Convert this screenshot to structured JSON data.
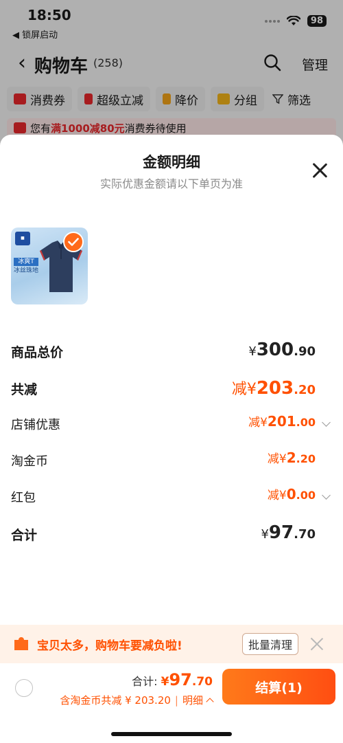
{
  "status_bar": {
    "time": "18:50",
    "back_label": "◀ 锁屏启动",
    "battery": "98"
  },
  "cart_header": {
    "back": "‹",
    "title": "购物车",
    "count": "(258)",
    "manage": "管理"
  },
  "filters": [
    {
      "label": "消费券",
      "color": "#e8272b"
    },
    {
      "label": "超级立减",
      "color": "#e8272b"
    },
    {
      "label": "降价",
      "color": "#f2a21a"
    },
    {
      "label": "分组",
      "color": "#f2b31a"
    },
    {
      "label": "筛选",
      "color": "#333333"
    }
  ],
  "coupon_banner": {
    "prefix": "您有",
    "highlight": "满1000减80元",
    "suffix": "消费券待使用"
  },
  "sheet": {
    "title": "金额明细",
    "subtitle": "实际优惠金额请以下单页为准",
    "product_thumb": {
      "tag_line1": "冰爽T",
      "tag_line2": "冰丝珠地"
    },
    "rows": [
      {
        "label": "商品总价",
        "prefix": "¥",
        "int": "300",
        "dec": ".90"
      },
      {
        "label": "共减",
        "prefix": "减¥",
        "int": "203",
        "dec": ".20"
      },
      {
        "label": "店铺优惠",
        "prefix": "减¥",
        "int": "201",
        "dec": ".00"
      },
      {
        "label": "淘金币",
        "prefix": "减¥",
        "int": "2",
        "dec": ".20"
      },
      {
        "label": "红包",
        "prefix": "减¥",
        "int": "0",
        "dec": ".00"
      },
      {
        "label": "合计",
        "prefix": "¥",
        "int": "97",
        "dec": ".70"
      }
    ]
  },
  "notice": {
    "text": "宝贝太多，购物车要减负啦!",
    "clean_button": "批量清理"
  },
  "checkout": {
    "total_label": "合计:",
    "total_prefix": "¥",
    "total_int": "97",
    "total_dec": ".70",
    "discount_text": "含淘金币共减 ¥ 203.20",
    "detail_label": "明细",
    "button_label": "结算(1)"
  },
  "colors": {
    "accent": "#ff5000",
    "red": "#e8272b"
  }
}
